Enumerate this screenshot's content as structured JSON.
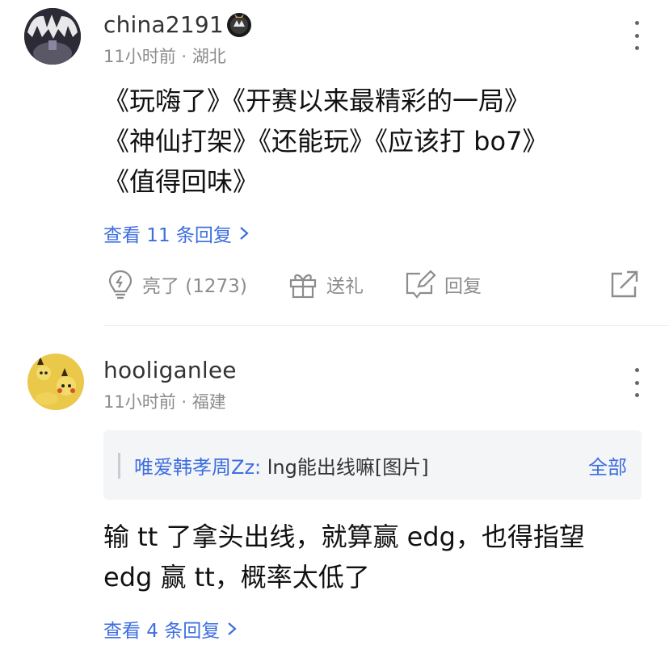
{
  "comments": [
    {
      "username": "china2191",
      "meta": "11小时前 · 湖北",
      "lines": [
        "《玩嗨了》《开赛以来最精彩的一局》",
        "《神仙打架》《还能玩》《应该打 bo7》",
        "《值得回味》"
      ],
      "replies_label": "查看 11 条回复",
      "actions": {
        "like_label": "亮了 (1273)",
        "gift_label": "送礼",
        "reply_label": "回复"
      }
    },
    {
      "username": "hooliganlee",
      "meta": "11小时前 · 福建",
      "quote": {
        "author": "唯爱韩孝周Zz:",
        "text": "lng能出线嘛[图片]",
        "all_label": "全部"
      },
      "lines": [
        "输 tt 了拿头出线，就算赢 edg，也得指望",
        "edg 赢 tt，概率太低了"
      ],
      "replies_label": "查看 4 条回复"
    }
  ],
  "colors": {
    "link": "#3d6ee0",
    "meta": "#8c8c8c",
    "quote_bg": "#f4f5f7"
  },
  "icons": [
    "badge-icon",
    "more-icon",
    "lightbulb-icon",
    "gift-icon",
    "edit-icon",
    "share-icon",
    "chevron-right-icon"
  ]
}
